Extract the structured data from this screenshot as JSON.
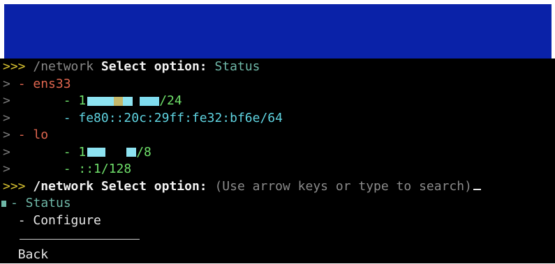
{
  "terminal": {
    "prompt_symbol": ">>>",
    "command": "/network",
    "lines": [
      {
        "question": "Select option:",
        "answer": "Status"
      },
      {
        "ens33_label": "- ens33"
      },
      {
        "ipv4_prefix": "- 1",
        "ipv4_suffix": "/24"
      },
      {
        "ipv6": "- fe80::20c:29ff:fe32:bf6e/64"
      },
      {
        "lo_label": "- lo"
      },
      {
        "lo_ipv4_prefix": "- 1",
        "lo_ipv4_suffix": "/8"
      },
      {
        "lo_ipv6": "- ::1/128"
      }
    ],
    "second_question": "Select option:",
    "hint": "(Use arrow keys or type to search)",
    "options": [
      "- Status",
      "- Configure"
    ],
    "back": "Back"
  }
}
